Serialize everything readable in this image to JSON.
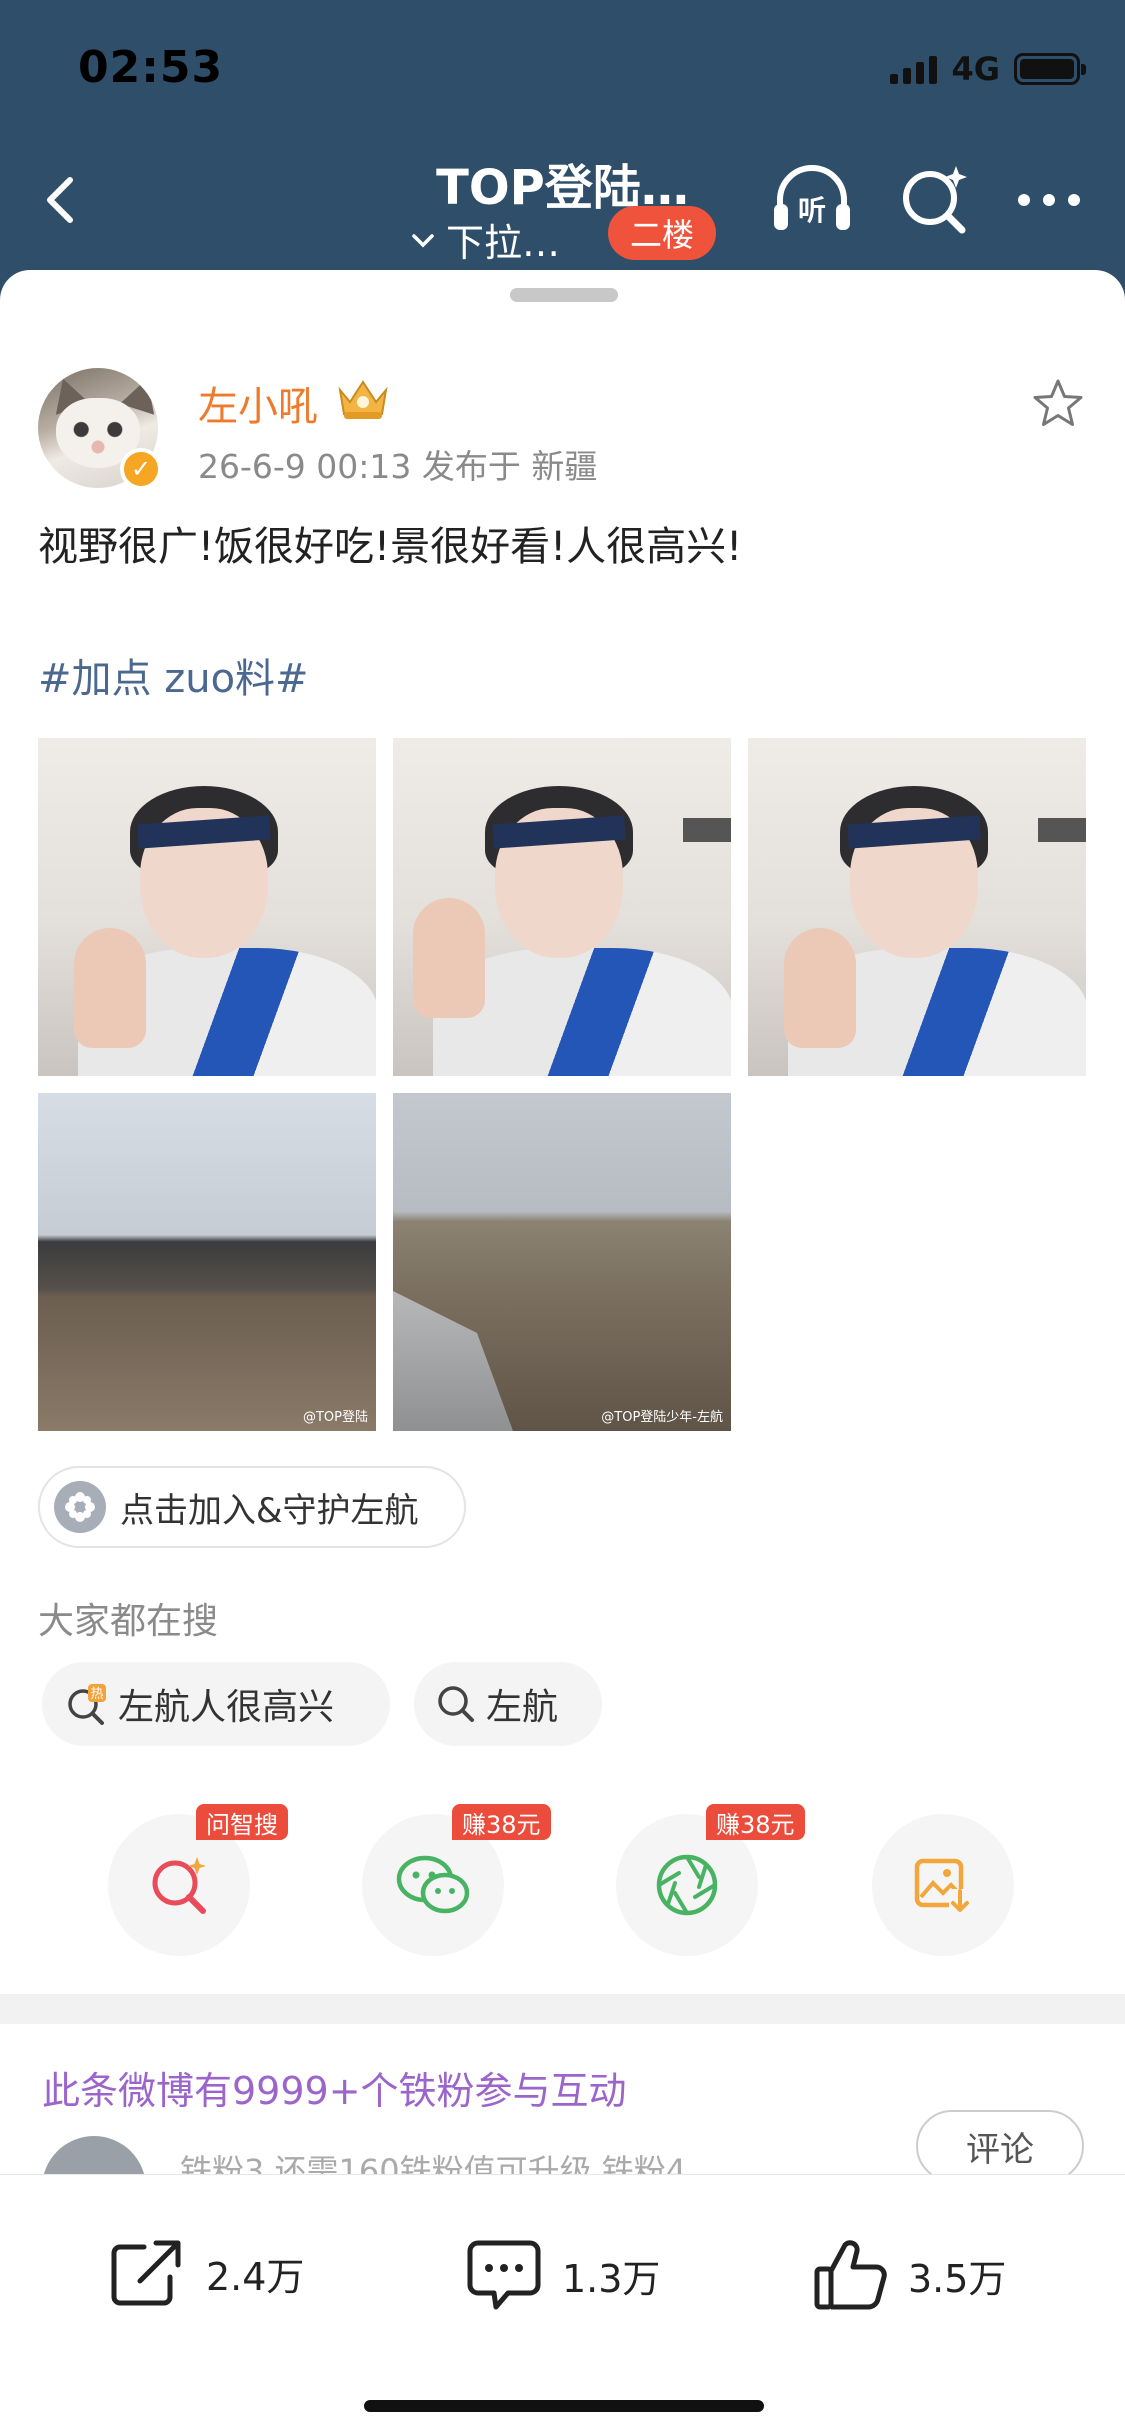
{
  "status": {
    "time": "02:53",
    "network": "4G"
  },
  "nav": {
    "title": "TOP登陆…",
    "subtitle": "下拉…",
    "floor_badge": "二楼",
    "listen_icon_label": "听"
  },
  "post": {
    "username": "左小吼",
    "meta": "26-6-9 00:13  发布于 新疆",
    "text": "视野很广!饭很好吃!景很好看!人很高兴!",
    "hashtag": "#加点 zuo料#",
    "watermarks": [
      "@TOP登陆",
      "@TOP登陆少年-左航"
    ]
  },
  "join": {
    "label": "点击加入&守护左航"
  },
  "searching": {
    "label": "大家都在搜",
    "chips": [
      {
        "label": "左航人很高兴",
        "icon": "hot-search-icon"
      },
      {
        "label": "左航",
        "icon": "search-icon"
      }
    ]
  },
  "share": {
    "items": [
      {
        "icon": "ai-search-icon",
        "tag": "问智搜"
      },
      {
        "icon": "wechat-icon",
        "tag": "赚38元"
      },
      {
        "icon": "moments-icon",
        "tag": "赚38元"
      },
      {
        "icon": "save-image-icon",
        "tag": ""
      }
    ]
  },
  "ironfans": {
    "text": "此条微博有9999+个铁粉参与互动",
    "comment_button": "评论",
    "peek_text": "铁粉3    还需160铁粉值可升级    铁粉4"
  },
  "bottom": {
    "repost": "2.4万",
    "comments": "1.3万",
    "likes": "3.5万"
  },
  "colors": {
    "header_bg": "#2f4e6a",
    "username": "#ee7b2c",
    "hashtag": "#4c6890",
    "ironfans": "#9b65cc",
    "badge": "#f0533c"
  }
}
